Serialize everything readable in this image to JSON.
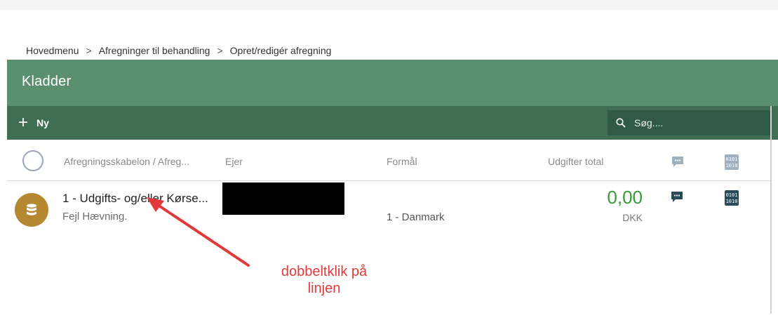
{
  "breadcrumb": {
    "items": [
      "Hovedmenu",
      "Afregninger til behandling",
      "Opret/redigér afregning"
    ],
    "separator": ">"
  },
  "header": {
    "title": "Kladder",
    "color": "#5a8f6f"
  },
  "toolbar": {
    "new_label": "Ny",
    "search_placeholder": "Søg....",
    "color": "#3f6e53"
  },
  "columns": {
    "template": "Afregningsskabelon / Afreg...",
    "owner": "Ejer",
    "purpose": "Formål",
    "total": "Udgifter total",
    "comment_icon": "comment-icon",
    "binary_icon": "binary-icon"
  },
  "row": {
    "title": "1 - Udgifts- og/eller Kørse...",
    "subtitle": "Fejl Hævning.",
    "purpose": "1 - Danmark",
    "amount": "0,00",
    "currency": "DKK",
    "avatar_icon": "database-icon",
    "avatar_color": "#b48730",
    "amount_color": "#3a9a3a"
  },
  "annotation": {
    "line1": "dobbeltklik på",
    "line2": "linjen",
    "color": "#e23a3a"
  }
}
